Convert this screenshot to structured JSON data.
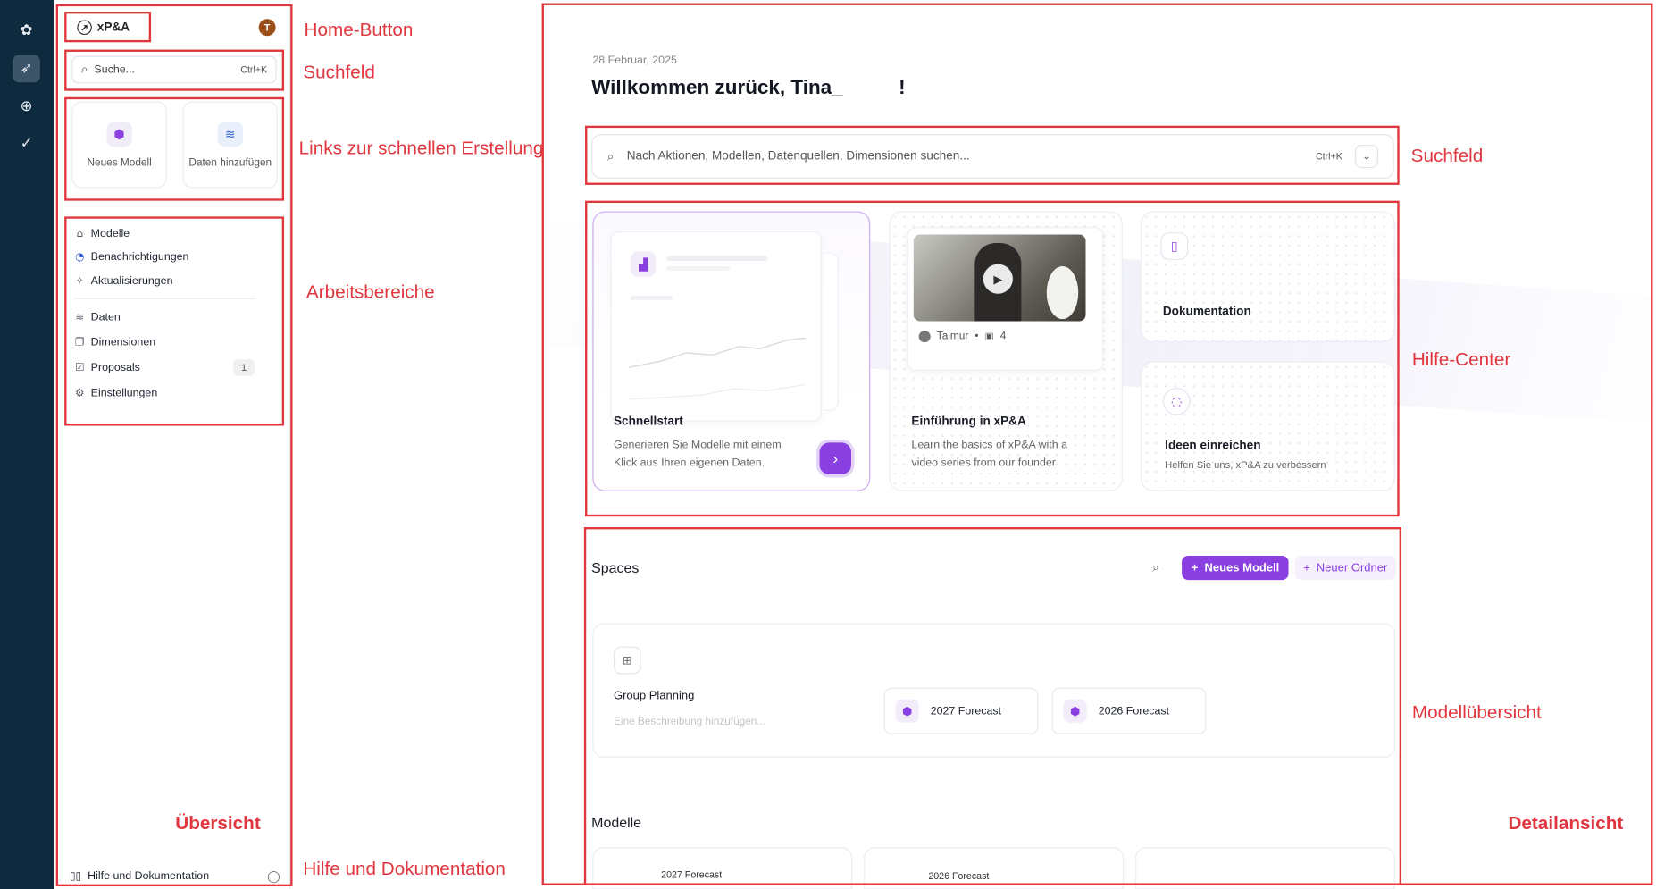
{
  "rail": {
    "icons": [
      "flower-icon",
      "compass-icon",
      "globe-icon",
      "check-circle-icon"
    ]
  },
  "sidebar": {
    "brand": "xP&A",
    "avatar_letter": "T",
    "search_placeholder": "Suche...",
    "search_shortcut": "Ctrl+K",
    "quick_actions": [
      {
        "label": "Neues Modell",
        "icon": "cube-icon"
      },
      {
        "label": "Daten hinzufügen",
        "icon": "database-icon"
      }
    ],
    "nav": [
      {
        "label": "Modelle",
        "icon": "home-icon"
      },
      {
        "label": "Benachrichtigungen",
        "icon": "bell-icon"
      },
      {
        "label": "Aktualisierungen",
        "icon": "sparkle-icon"
      },
      {
        "label": "Daten",
        "icon": "database-icon"
      },
      {
        "label": "Dimensionen",
        "icon": "layers-icon"
      },
      {
        "label": "Proposals",
        "icon": "checkbox-icon",
        "badge": "1"
      },
      {
        "label": "Einstellungen",
        "icon": "gear-icon"
      }
    ],
    "help_label": "Hilfe und Dokumentation"
  },
  "annotations": {
    "home": "Home-Button",
    "sidebar_search": "Suchfeld",
    "quick_links": "Links zur schnellen Erstellung",
    "workspaces": "Arbeitsbereiche",
    "overview": "Übersicht",
    "help": "Hilfe und Dokumentation",
    "main_search": "Suchfeld",
    "help_center": "Hilfe-Center",
    "model_overview": "Modellübersicht",
    "detail_view": "Detailansicht"
  },
  "main": {
    "date": "28 Februar, 2025",
    "welcome": "Willkommen zurück, Tina_          !",
    "search_placeholder": "Nach Aktionen, Modellen, Datenquellen, Dimensionen suchen...",
    "search_shortcut": "Ctrl+K",
    "cards": {
      "quickstart": {
        "title": "Schnellstart",
        "desc_line1": "Generieren Sie Modelle mit einem",
        "desc_line2": "Klick aus Ihren eigenen Daten."
      },
      "intro": {
        "title": "Einführung in xP&A",
        "desc_line1": "Learn the basics of xP&A with a",
        "desc_line2": "video series from our founder",
        "author": "Taimur",
        "video_count": "4"
      },
      "docs": {
        "title": "Dokumentation"
      },
      "ideas": {
        "title": "Ideen einreichen",
        "desc": "Helfen Sie uns, xP&A zu verbessern"
      }
    },
    "spaces": {
      "title": "Spaces",
      "new_model": "Neues Modell",
      "new_folder": "Neuer Ordner",
      "group_title": "Group Planning",
      "group_desc_placeholder": "Eine Beschreibung hinzufügen...",
      "models": [
        "2027 Forecast",
        "2026 Forecast"
      ]
    },
    "models_section": {
      "title": "Modelle",
      "cards": [
        "2027 Forecast",
        "2026 Forecast"
      ]
    }
  }
}
